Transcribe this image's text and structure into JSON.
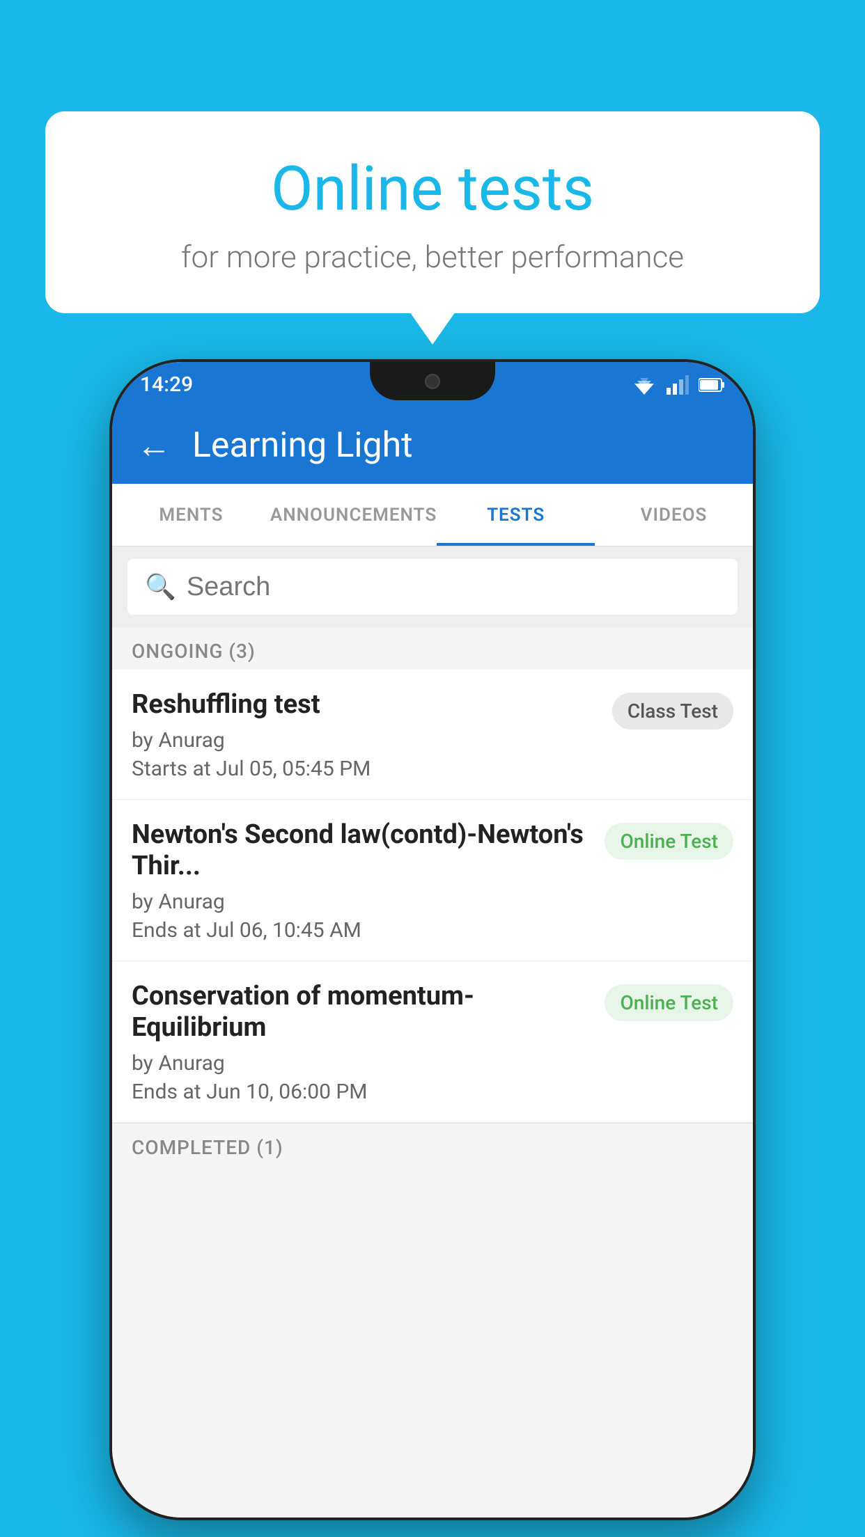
{
  "background_color": "#1ab8e8",
  "speech_bubble": {
    "title": "Online tests",
    "subtitle": "for more practice, better performance"
  },
  "phone": {
    "status_bar": {
      "time": "14:29",
      "bg_color": "#1976d2"
    },
    "app_bar": {
      "title": "Learning Light",
      "bg_color": "#1976d2",
      "back_label": "←"
    },
    "tabs": [
      {
        "label": "MENTS",
        "active": false
      },
      {
        "label": "ANNOUNCEMENTS",
        "active": false
      },
      {
        "label": "TESTS",
        "active": true
      },
      {
        "label": "VIDEOS",
        "active": false
      }
    ],
    "search": {
      "placeholder": "Search"
    },
    "section_ongoing": {
      "label": "ONGOING (3)"
    },
    "tests": [
      {
        "name": "Reshuffling test",
        "author": "by Anurag",
        "date_label": "Starts at",
        "date": "Jul 05, 05:45 PM",
        "badge": "Class Test",
        "badge_type": "class"
      },
      {
        "name": "Newton's Second law(contd)-Newton's Thir...",
        "author": "by Anurag",
        "date_label": "Ends at",
        "date": "Jul 06, 10:45 AM",
        "badge": "Online Test",
        "badge_type": "online"
      },
      {
        "name": "Conservation of momentum-Equilibrium",
        "author": "by Anurag",
        "date_label": "Ends at",
        "date": "Jun 10, 06:00 PM",
        "badge": "Online Test",
        "badge_type": "online"
      }
    ],
    "section_completed": {
      "label": "COMPLETED (1)"
    }
  }
}
